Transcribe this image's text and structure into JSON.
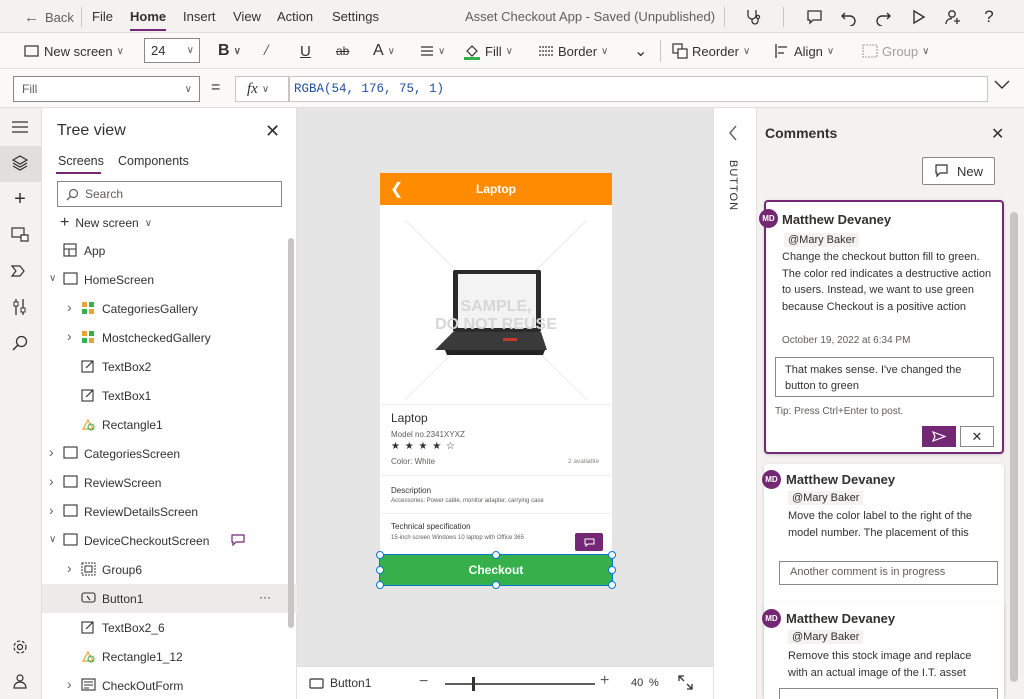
{
  "topbar": {
    "back_label": "Back",
    "menu": [
      "File",
      "Home",
      "Insert",
      "View",
      "Action",
      "Settings"
    ],
    "active_menu": "Home",
    "app_title": "Asset Checkout App - Saved (Unpublished)"
  },
  "ribbon": {
    "new_screen": "New screen",
    "font_size": "24",
    "fill": "Fill",
    "border": "Border",
    "reorder": "Reorder",
    "align": "Align",
    "group": "Group"
  },
  "formula": {
    "property": "Fill",
    "fx": "fx",
    "value": "RGBA(54, 176, 75, 1)"
  },
  "tree": {
    "title": "Tree view",
    "tabs": [
      "Screens",
      "Components"
    ],
    "search_placeholder": "Search",
    "new_screen": "New screen",
    "items": [
      {
        "label": "App",
        "level": 0,
        "icon": "app-icon",
        "caret": ""
      },
      {
        "label": "HomeScreen",
        "level": 0,
        "icon": "screen-icon",
        "caret": "down"
      },
      {
        "label": "CategoriesGallery",
        "level": 1,
        "icon": "gallery-icon",
        "caret": "right"
      },
      {
        "label": "MostcheckedGallery",
        "level": 1,
        "icon": "gallery-icon",
        "caret": "right"
      },
      {
        "label": "TextBox2",
        "level": 1,
        "icon": "edit-icon",
        "caret": ""
      },
      {
        "label": "TextBox1",
        "level": 1,
        "icon": "edit-icon",
        "caret": ""
      },
      {
        "label": "Rectangle1",
        "level": 1,
        "icon": "shape-icon",
        "caret": ""
      },
      {
        "label": "CategoriesScreen",
        "level": 0,
        "icon": "screen-icon",
        "caret": "right"
      },
      {
        "label": "ReviewScreen",
        "level": 0,
        "icon": "screen-icon",
        "caret": "right"
      },
      {
        "label": "ReviewDetailsScreen",
        "level": 0,
        "icon": "screen-icon",
        "caret": "right"
      },
      {
        "label": "DeviceCheckoutScreen",
        "level": 0,
        "icon": "screen-icon",
        "caret": "down"
      },
      {
        "label": "Group6",
        "level": 1,
        "icon": "group-icon",
        "caret": "right"
      },
      {
        "label": "Button1",
        "level": 1,
        "icon": "button-icon",
        "caret": ""
      },
      {
        "label": "TextBox2_6",
        "level": 1,
        "icon": "edit-icon",
        "caret": ""
      },
      {
        "label": "Rectangle1_12",
        "level": 1,
        "icon": "shape-icon",
        "caret": ""
      },
      {
        "label": "CheckOutForm",
        "level": 1,
        "icon": "form-icon",
        "caret": "right"
      }
    ],
    "selected": "Button1",
    "more": "···"
  },
  "phone": {
    "header_title": "Laptop",
    "watermark_line1": "SAMPLE,",
    "watermark_line2": "DO NOT REUSE",
    "product_name": "Laptop",
    "model": "Model no.2341XYXZ",
    "stars": "★ ★ ★ ★ ☆",
    "color": "Color: White",
    "available": "2 available",
    "desc_title": "Description",
    "desc_text": "Accessories: Power cable, monitor adapter, carrying case",
    "spec_title": "Technical specification",
    "spec_text": "15-inch screen Windows 10 laptop with Office 365",
    "checkout_label": "Checkout",
    "colors": {
      "header": "#ff8c00",
      "button": "#36b04b"
    }
  },
  "statusbar": {
    "selected": "Button1",
    "zoom": "40",
    "zoom_unit": "%"
  },
  "vertical_label": "BUTTON",
  "comments": {
    "title": "Comments",
    "new_label": "New",
    "thread1": {
      "avatar": "MD",
      "author": "Matthew Devaney",
      "mention": "@Mary Baker",
      "text": "Change the checkout button fill to green. The color red indicates a destructive action to users.  Instead, we want to use green because Checkout is a positive action",
      "timestamp": "October 19, 2022 at 6:34 PM",
      "reply": "That makes sense.  I've changed the button to green",
      "tip": "Tip: Press Ctrl+Enter to post."
    },
    "thread2": {
      "avatar": "MD",
      "author": "Matthew Devaney",
      "mention": "@Mary Baker",
      "text": "Move the color label to the right of the model number.  The placement of this",
      "reply_placeholder": "Another comment is in progress"
    },
    "thread3": {
      "avatar": "MD",
      "author": "Matthew Devaney",
      "mention": "@Mary Baker",
      "text": "Remove this stock image and replace with an actual image of the I.T. asset"
    }
  }
}
